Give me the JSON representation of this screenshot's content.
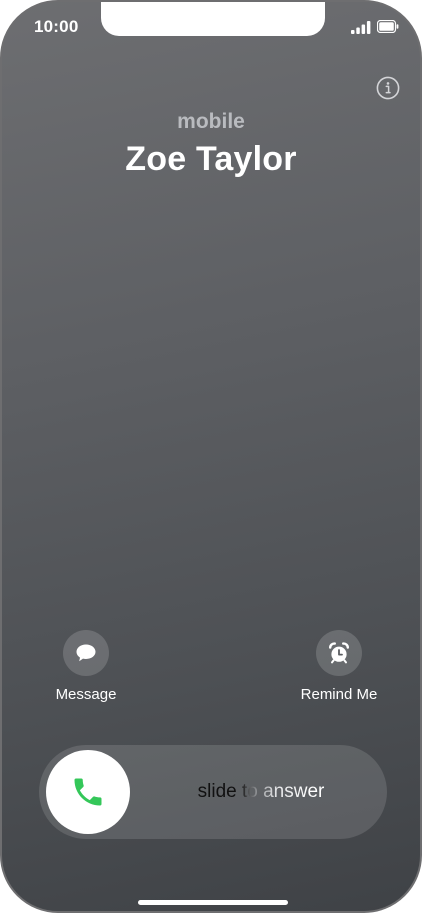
{
  "status_bar": {
    "time": "10:00",
    "signal_icon": "cellular-signal-icon",
    "battery_icon": "battery-icon"
  },
  "info_button": {
    "icon": "info-icon"
  },
  "caller": {
    "type": "mobile",
    "name": "Zoe Taylor"
  },
  "actions": {
    "message": {
      "icon": "message-bubble-icon",
      "label": "Message"
    },
    "remind": {
      "icon": "alarm-clock-icon",
      "label": "Remind Me"
    }
  },
  "answer_slider": {
    "icon": "phone-icon",
    "accent_color": "#34c759",
    "text": "slide to answer"
  },
  "colors": {
    "background_top": "#6d6e71",
    "background_bottom": "#3f4246"
  }
}
